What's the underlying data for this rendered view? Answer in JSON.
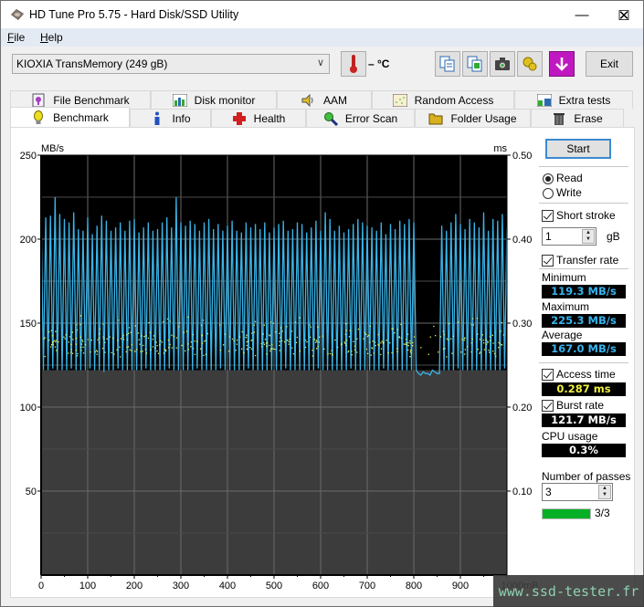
{
  "window": {
    "title": "HD Tune Pro 5.75 - Hard Disk/SSD Utility",
    "minimize": "—",
    "maximize": "☐",
    "close": "✕"
  },
  "menu": {
    "items": [
      {
        "label": "File",
        "accel": "F",
        "rest": "ile"
      },
      {
        "label": "Help",
        "accel": "H",
        "rest": "elp"
      }
    ]
  },
  "toolbar": {
    "drive": "KIOXIA  TransMemory (249 gB)",
    "temperature": "– °C",
    "icons": [
      "copy-text-icon",
      "copy-screenshot-icon",
      "camera-icon",
      "options-icon",
      "save-download-icon"
    ],
    "exit_label": "Exit"
  },
  "tabs": {
    "top_row": [
      {
        "label": "File Benchmark",
        "icon": "file-benchmark-icon"
      },
      {
        "label": "Disk monitor",
        "icon": "disk-monitor-icon"
      },
      {
        "label": "AAM",
        "icon": "speaker-icon"
      },
      {
        "label": "Random Access",
        "icon": "random-access-icon"
      },
      {
        "label": "Extra tests",
        "icon": "extra-tests-icon"
      }
    ],
    "bottom_row": [
      {
        "label": "Benchmark",
        "icon": "lightbulb-icon",
        "active": true
      },
      {
        "label": "Info",
        "icon": "info-icon"
      },
      {
        "label": "Health",
        "icon": "health-cross-icon"
      },
      {
        "label": "Error Scan",
        "icon": "magnifier-icon"
      },
      {
        "label": "Folder Usage",
        "icon": "folder-icon"
      },
      {
        "label": "Erase",
        "icon": "trash-icon"
      }
    ]
  },
  "controls": {
    "start_label": "Start",
    "mode_options": [
      {
        "label": "Read",
        "selected": true
      },
      {
        "label": "Write",
        "selected": false
      }
    ],
    "short_stroke": {
      "label": "Short stroke",
      "checked": true,
      "value": "1",
      "unit": "gB"
    },
    "transfer_rate": {
      "label": "Transfer rate",
      "checked": true
    },
    "minimum": {
      "label": "Minimum",
      "value": "119.3 MB/s"
    },
    "maximum": {
      "label": "Maximum",
      "value": "225.3 MB/s"
    },
    "average": {
      "label": "Average",
      "value": "167.0 MB/s"
    },
    "access_time": {
      "label": "Access time",
      "checked": true,
      "value": "0.287 ms"
    },
    "burst_rate": {
      "label": "Burst rate",
      "checked": true,
      "value": "121.7 MB/s"
    },
    "cpu_usage": {
      "label": "CPU usage",
      "value": "0.3%"
    },
    "passes": {
      "label": "Number of passes",
      "value": "3",
      "progress_text": "3/3",
      "progress_fraction": 1.0
    }
  },
  "colors": {
    "transfer_line": "#3ab4e8",
    "access_dots": "#e8f060",
    "readout_blue": "#36b4f0",
    "readout_yellow": "#f0f040",
    "readout_white": "#ffffff",
    "progress_green": "#06b025"
  },
  "watermark": "www.ssd-tester.fr",
  "chart_data": {
    "type": "line",
    "title": "",
    "xlabel": "mB",
    "ylabel": "MB/s",
    "y2label": "ms",
    "xlim": [
      0,
      1000
    ],
    "ylim": [
      0,
      250
    ],
    "y2lim": [
      0,
      0.5
    ],
    "x_ticks": [
      "0",
      "100",
      "200",
      "300",
      "400",
      "500",
      "600",
      "700",
      "800",
      "900",
      "1000mB"
    ],
    "y_ticks": [
      "250",
      "200",
      "150",
      "100",
      "50"
    ],
    "y2_ticks": [
      "0.50",
      "0.40",
      "0.30",
      "0.20",
      "0.10"
    ],
    "grid": true,
    "series": [
      {
        "name": "Transfer rate",
        "unit": "MB/s",
        "description": "Oscillating between ~122 and ~215 MB/s with peaks ~225; dip to ~120 flat between 805-850 mB",
        "min": 119.3,
        "max": 225.3,
        "avg": 167.0,
        "x": [
          0,
          10,
          20,
          30,
          40,
          50,
          60,
          70,
          80,
          90,
          100,
          110,
          120,
          130,
          140,
          150,
          160,
          170,
          180,
          190,
          200,
          210,
          220,
          230,
          240,
          250,
          260,
          270,
          280,
          290,
          300,
          310,
          320,
          330,
          340,
          350,
          360,
          370,
          380,
          390,
          400,
          410,
          420,
          430,
          440,
          450,
          460,
          470,
          480,
          490,
          500,
          510,
          520,
          530,
          540,
          550,
          560,
          570,
          580,
          590,
          600,
          610,
          620,
          630,
          640,
          650,
          660,
          670,
          680,
          690,
          700,
          710,
          720,
          730,
          740,
          750,
          760,
          770,
          780,
          790,
          800,
          810,
          820,
          830,
          840,
          850,
          860,
          870,
          880,
          890,
          900,
          910,
          920,
          930,
          940,
          950,
          960,
          970,
          980,
          990,
          1000
        ],
        "peaks": [
          216,
          213,
          214,
          225,
          215,
          212,
          210,
          216,
          206,
          205,
          213,
          203,
          208,
          214,
          211,
          205,
          207,
          210,
          205,
          211,
          212,
          204,
          207,
          210,
          205,
          206,
          210,
          213,
          207,
          225,
          210,
          208,
          211,
          209,
          205,
          210,
          212,
          206,
          209,
          205,
          208,
          211,
          205,
          204,
          210,
          207,
          209,
          206,
          210,
          204,
          207,
          209,
          211,
          205,
          206,
          210,
          209,
          204,
          207,
          211,
          205,
          216,
          212,
          205,
          208,
          204,
          206,
          209,
          212,
          210,
          208,
          207,
          205,
          210,
          203,
          209,
          206,
          211,
          209,
          212,
          210,
          120,
          121,
          120,
          122,
          120,
          208,
          205,
          210,
          215,
          209,
          206,
          212,
          210,
          207,
          216,
          205,
          212,
          211,
          215,
          207
        ],
        "troughs": [
          122,
          122,
          123,
          122,
          122,
          122,
          123,
          122,
          122,
          122,
          123,
          122,
          122,
          121,
          122,
          122,
          123,
          122,
          122,
          122,
          122,
          122,
          123,
          122,
          122,
          122,
          122,
          123,
          122,
          122,
          122,
          122,
          122,
          123,
          122,
          122,
          122,
          122,
          123,
          122,
          122,
          122,
          122,
          122,
          123,
          122,
          122,
          122,
          122,
          122,
          122,
          122,
          123,
          122,
          122,
          122,
          122,
          122,
          122,
          123,
          122,
          122,
          122,
          122,
          122,
          122,
          123,
          122,
          122,
          122,
          122,
          122,
          122,
          123,
          122,
          122,
          122,
          122,
          122,
          122,
          122,
          119,
          120,
          119,
          121,
          120,
          122,
          122,
          122,
          123,
          122,
          122,
          122,
          122,
          122,
          122,
          122,
          122,
          122,
          123,
          122
        ]
      },
      {
        "name": "Access time",
        "unit": "ms",
        "type": "scatter",
        "description": "Dense scatter of points between ~0.27 and ~0.31 ms across the range",
        "average": 0.287,
        "range": [
          0.26,
          0.32
        ]
      }
    ]
  }
}
